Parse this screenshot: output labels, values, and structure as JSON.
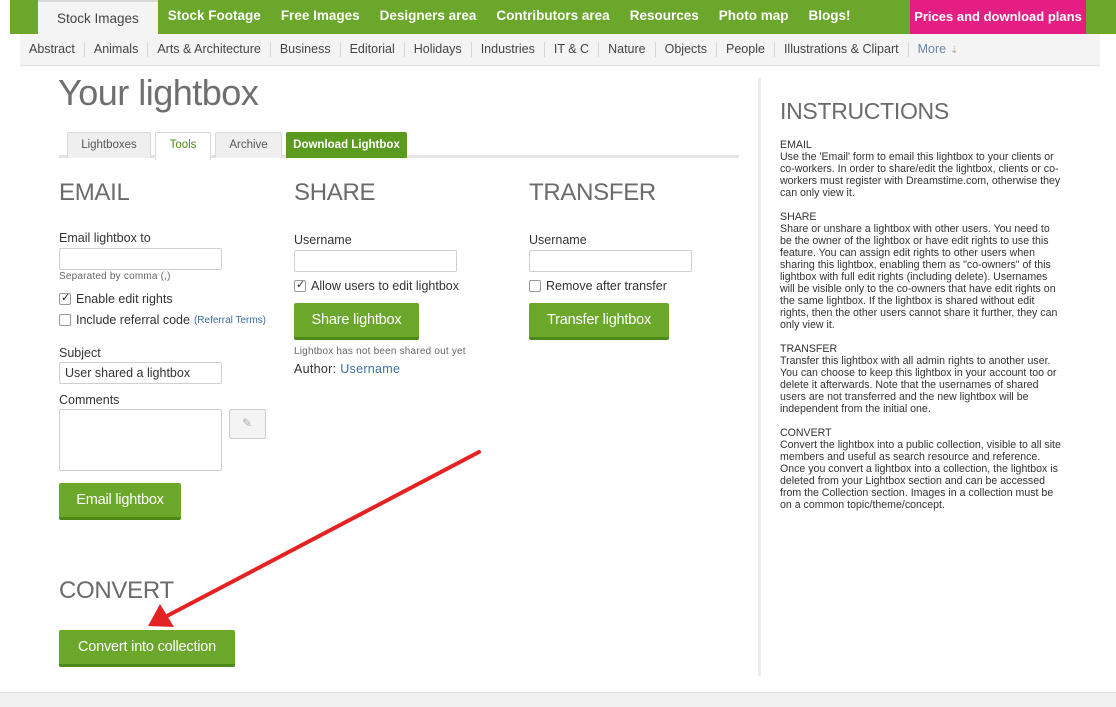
{
  "topnav": {
    "items": [
      "Stock Images",
      "Stock Footage",
      "Free Images",
      "Designers area",
      "Contributors area",
      "Resources",
      "Photo map",
      "Blogs!"
    ],
    "cta": "Prices and download plans"
  },
  "catnav": {
    "items": [
      "Abstract",
      "Animals",
      "Arts & Architecture",
      "Business",
      "Editorial",
      "Holidays",
      "Industries",
      "IT & C",
      "Nature",
      "Objects",
      "People",
      "Illustrations & Clipart"
    ],
    "more": "More"
  },
  "page": {
    "title": "Your lightbox"
  },
  "tabs": [
    "Lightboxes",
    "Tools",
    "Archive",
    "Download Lightbox"
  ],
  "email": {
    "heading": "EMAIL",
    "to_label": "Email lightbox to",
    "to_value": "",
    "hint": "Separated by comma (,)",
    "enable_edit_label": "Enable edit rights",
    "enable_edit_checked": true,
    "referral_label": "Include referral code",
    "referral_checked": false,
    "referral_terms": "(Referral Terms)",
    "subject_label": "Subject",
    "subject_value": "User shared a lightbox",
    "comments_label": "Comments",
    "button": "Email lightbox"
  },
  "share": {
    "heading": "SHARE",
    "username_label": "Username",
    "allow_edit_label": "Allow users to edit lightbox",
    "allow_edit_checked": true,
    "button": "Share lightbox",
    "status": "Lightbox has not been shared out yet",
    "author_label": "Author:",
    "author_value": "Username"
  },
  "transfer": {
    "heading": "TRANSFER",
    "username_label": "Username",
    "remove_label": "Remove after transfer",
    "remove_checked": false,
    "button": "Transfer lightbox"
  },
  "convert": {
    "heading": "CONVERT",
    "button": "Convert into collection"
  },
  "instructions": {
    "heading": "INSTRUCTIONS",
    "sections": [
      {
        "title": "EMAIL",
        "body": "Use the 'Email' form to email this lightbox to your clients or co-workers. In order to share/edit the lightbox, clients or co-workers must register with Dreamstime.com, otherwise they can only view it."
      },
      {
        "title": "SHARE",
        "body": "Share or unshare a lightbox with other users. You need to be the owner of the lightbox or have edit rights to use this feature. You can assign edit rights to other users when sharing this lightbox, enabling them as \"co-owners\" of this lightbox with full edit rights (including delete). Usernames will be visible only to the co-owners that have edit rights on the same lightbox. If the lightbox is shared without edit rights, then the other users cannot share it further, they can only view it."
      },
      {
        "title": "TRANSFER",
        "body": "Transfer this lightbox with all admin rights to another user. You can choose to keep this lightbox in your account too or delete it afterwards. Note that the usernames of shared users are not transferred and the new lightbox will be independent from the initial one."
      },
      {
        "title": "CONVERT",
        "body": "Convert the lightbox into a public collection, visible to all site members and useful as search resource and reference. Once you convert a lightbox into a collection, the lightbox is deleted from your Lightbox section and can be accessed from the Collection section. Images in a collection must be on a common topic/theme/concept."
      }
    ]
  },
  "colors": {
    "green": "#6aa72a",
    "pink": "#e51e83",
    "arrow": "#e52222"
  }
}
